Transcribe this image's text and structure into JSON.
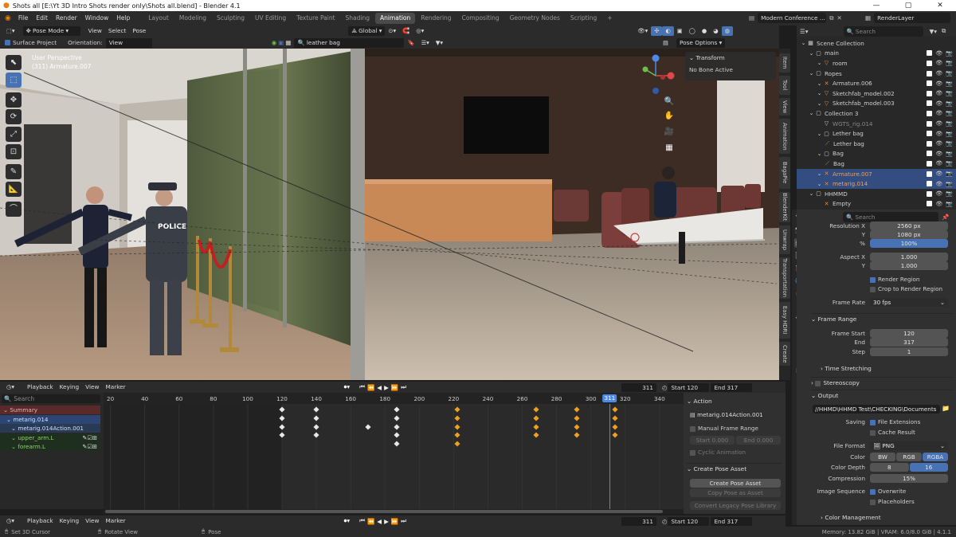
{
  "titlebar": {
    "title": "Shots all [E:\\Yt 3D Intro Shots render only\\Shots all.blend] - Blender 4.1"
  },
  "menubar": {
    "items": [
      "File",
      "Edit",
      "Render",
      "Window",
      "Help"
    ]
  },
  "workspaces": {
    "tabs": [
      "Layout",
      "Modeling",
      "Sculpting",
      "UV Editing",
      "Texture Paint",
      "Shading",
      "Animation",
      "Rendering",
      "Compositing",
      "Geometry Nodes",
      "Scripting"
    ],
    "active": "Animation",
    "add": "+"
  },
  "scene": {
    "name": "Modern Conference ...",
    "view_layer": "RenderLayer"
  },
  "viewport_header": {
    "mode": "Pose Mode",
    "view": "View",
    "select": "Select",
    "pose": "Pose",
    "orientation_space": "Global",
    "surface_project": "Surface Project",
    "orientation_label": "Orientation:",
    "orientation_value": "View",
    "search": "leather bag",
    "pose_options": "Pose Options"
  },
  "viewport": {
    "perspective": "User Perspective",
    "object": "(311) Armature.007",
    "transform_title": "Transform",
    "transform_body": "No Bone Active",
    "police_label": "POLICE"
  },
  "vtabs": [
    "Item",
    "Tool",
    "View",
    "Animation",
    "BagaPie",
    "BlenderKit",
    "Unwrap",
    "Transportation",
    "Easy HDRI",
    "Create"
  ],
  "outliner": {
    "search_placeholder": "Search",
    "rows": [
      {
        "label": "Scene Collection",
        "indent": 0
      },
      {
        "label": "main",
        "indent": 1
      },
      {
        "label": "room",
        "indent": 2
      },
      {
        "label": "Ropes",
        "indent": 1
      },
      {
        "label": "Armature.006",
        "indent": 2
      },
      {
        "label": "Sketchfab_model.002",
        "indent": 2
      },
      {
        "label": "Sketchfab_model.003",
        "indent": 2
      },
      {
        "label": "Collection 3",
        "indent": 1
      },
      {
        "label": "WGTS_rig.014",
        "indent": 2
      },
      {
        "label": "Lether bag",
        "indent": 2
      },
      {
        "label": "Lether bag",
        "indent": 3
      },
      {
        "label": "Bag",
        "indent": 2
      },
      {
        "label": "Bag",
        "indent": 3
      },
      {
        "label": "Armature.007",
        "indent": 2
      },
      {
        "label": "metarig.014",
        "indent": 2
      },
      {
        "label": "HHMMD",
        "indent": 1
      },
      {
        "label": "Empty",
        "indent": 2
      }
    ]
  },
  "properties": {
    "search_placeholder": "Search",
    "resolution_x_label": "Resolution X",
    "resolution_x": "2560 px",
    "y_label": "Y",
    "resolution_y": "1080 px",
    "pct_label": "%",
    "resolution_pct": "100%",
    "aspect_x_label": "Aspect X",
    "aspect_x": "1.000",
    "aspect_y_label": "Y",
    "aspect_y": "1.000",
    "render_region": "Render Region",
    "crop_region": "Crop to Render Region",
    "frame_rate_label": "Frame Rate",
    "frame_rate": "30 fps",
    "frame_range_section": "Frame Range",
    "frame_start_label": "Frame Start",
    "frame_start": "120",
    "end_label": "End",
    "frame_end": "317",
    "step_label": "Step",
    "frame_step": "1",
    "time_stretching": "Time Stretching",
    "stereoscopy": "Stereoscopy",
    "output_section": "Output",
    "output_path": "//HHMD\\HHMD Test\\CHECKING\\Documents",
    "saving_label": "Saving",
    "file_extensions": "File Extensions",
    "cache_result": "Cache Result",
    "file_format_label": "File Format",
    "file_format": "PNG",
    "color_label": "Color",
    "color_options": [
      "BW",
      "RGB",
      "RGBA"
    ],
    "color_active": "RGBA",
    "color_depth_label": "Color Depth",
    "depth_options": [
      "8",
      "16"
    ],
    "depth_active": "16",
    "compression_label": "Compression",
    "compression": "15%",
    "image_sequence_label": "Image Sequence",
    "overwrite": "Overwrite",
    "placeholders": "Placeholders",
    "color_management": "Color Management"
  },
  "timeline": {
    "menu": [
      "Playback",
      "Keying",
      "View",
      "Marker"
    ],
    "current_frame": "311",
    "start_label": "Start",
    "start": "120",
    "end_label": "End",
    "end": "317",
    "search_placeholder": "Search",
    "ruler": [
      20,
      40,
      60,
      80,
      100,
      120,
      140,
      160,
      180,
      200,
      220,
      240,
      260,
      280,
      300,
      320,
      340
    ],
    "playhead_frame": 311,
    "frame_min": 16,
    "frame_max": 354,
    "channels": [
      {
        "label": "Summary",
        "kind": "summary"
      },
      {
        "label": "metarig.014",
        "kind": "object"
      },
      {
        "label": "metarig.014Action.001",
        "kind": "action"
      },
      {
        "label": "upper_arm.L",
        "kind": "group"
      },
      {
        "label": "forearm.L",
        "kind": "group"
      }
    ],
    "keyframes": [
      {
        "frame": 120,
        "rows": [
          0,
          1,
          2,
          3
        ],
        "color": "w"
      },
      {
        "frame": 140,
        "rows": [
          0,
          1,
          2,
          3
        ],
        "color": "w"
      },
      {
        "frame": 170,
        "rows": [
          2
        ],
        "color": "w"
      },
      {
        "frame": 187,
        "rows": [
          0,
          1,
          2,
          3,
          4
        ],
        "color": "w"
      },
      {
        "frame": 222,
        "rows": [
          0,
          1,
          2,
          3,
          4
        ],
        "color": "o"
      },
      {
        "frame": 268,
        "rows": [
          0,
          1,
          2,
          3
        ],
        "color": "o"
      },
      {
        "frame": 292,
        "rows": [
          0,
          1,
          2,
          3
        ],
        "color": "o"
      },
      {
        "frame": 314,
        "rows": [
          0,
          1,
          2,
          3
        ],
        "color": "o"
      }
    ]
  },
  "action_panel": {
    "action_section": "Action",
    "action_name": "metarig.014Action.001",
    "manual_frame_range": "Manual Frame Range",
    "start_label": "Start",
    "start": "0.000",
    "end_label": "End",
    "end": "0.000",
    "cyclic": "Cyclic Animation",
    "pose_asset_section": "Create Pose Asset",
    "create_pose_asset": "Create Pose Asset",
    "copy_pose_asset": "Copy Pose as Asset",
    "convert_legacy": "Convert Legacy Pose Library"
  },
  "status": {
    "left": "Set 3D Cursor",
    "middle": "Rotate View",
    "right_action": "Pose",
    "memory": "Memory: 13.82 GiB | VRAM: 6.0/8.0 GiB | 4.1.1"
  }
}
